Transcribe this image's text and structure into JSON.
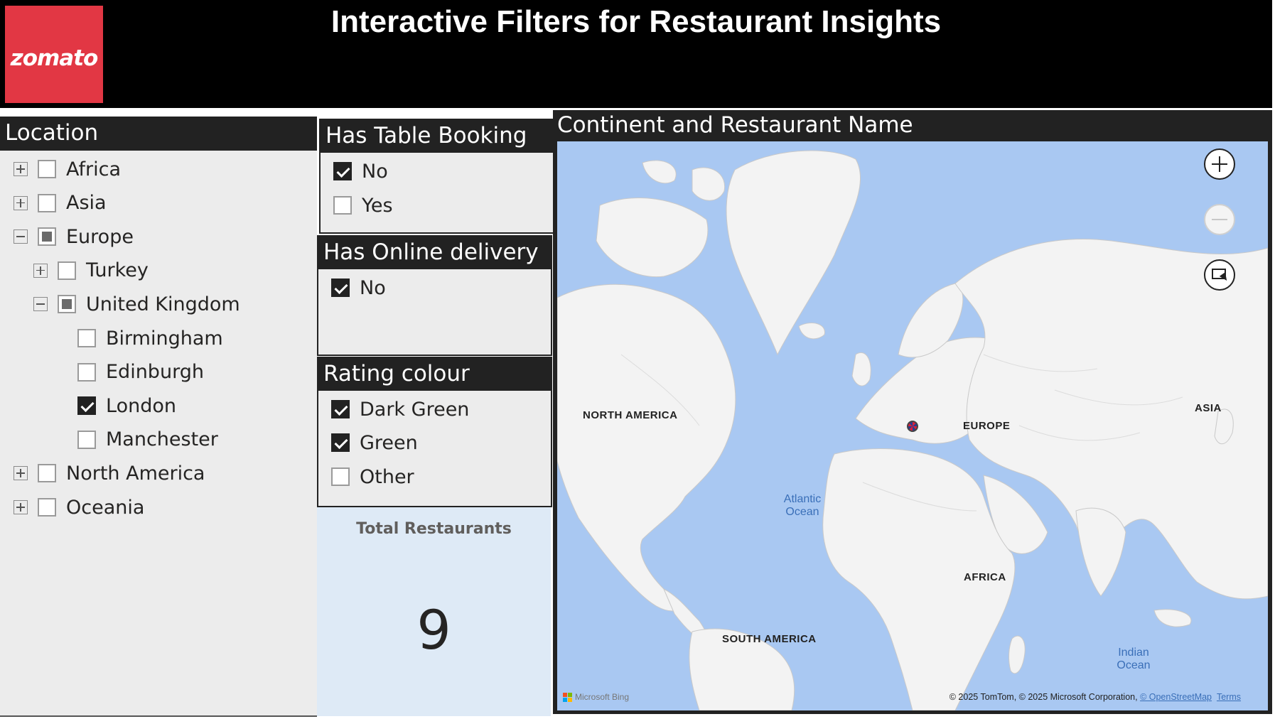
{
  "header": {
    "logo_text": "zomato",
    "title": "Interactive Filters for Restaurant Insights"
  },
  "location_slicer": {
    "title": "Location",
    "items": [
      {
        "label": "Africa",
        "level": 0,
        "expander": "plus",
        "state": "unchecked"
      },
      {
        "label": "Asia",
        "level": 0,
        "expander": "plus",
        "state": "unchecked"
      },
      {
        "label": "Europe",
        "level": 0,
        "expander": "minus",
        "state": "partial"
      },
      {
        "label": "Turkey",
        "level": 1,
        "expander": "plus",
        "state": "unchecked"
      },
      {
        "label": "United Kingdom",
        "level": 1,
        "expander": "minus",
        "state": "partial"
      },
      {
        "label": "Birmingham",
        "level": 2,
        "expander": "none",
        "state": "unchecked"
      },
      {
        "label": "Edinburgh",
        "level": 2,
        "expander": "none",
        "state": "unchecked"
      },
      {
        "label": "London",
        "level": 2,
        "expander": "none",
        "state": "checked"
      },
      {
        "label": "Manchester",
        "level": 2,
        "expander": "none",
        "state": "unchecked"
      },
      {
        "label": "North America",
        "level": 0,
        "expander": "plus",
        "state": "unchecked"
      },
      {
        "label": "Oceania",
        "level": 0,
        "expander": "plus",
        "state": "unchecked"
      }
    ]
  },
  "table_booking_slicer": {
    "title": "Has Table Booking",
    "items": [
      {
        "label": "No",
        "state": "checked"
      },
      {
        "label": "Yes",
        "state": "unchecked"
      }
    ]
  },
  "online_delivery_slicer": {
    "title": "Has Online delivery",
    "items": [
      {
        "label": "No",
        "state": "checked"
      }
    ]
  },
  "rating_colour_slicer": {
    "title": "Rating colour",
    "items": [
      {
        "label": "Dark Green",
        "state": "checked"
      },
      {
        "label": "Green",
        "state": "checked"
      },
      {
        "label": "Other",
        "state": "unchecked"
      }
    ]
  },
  "total_card": {
    "title": "Total Restaurants",
    "value": "9"
  },
  "map": {
    "title": "Continent and Restaurant Name",
    "labels": {
      "north_america": "NORTH AMERICA",
      "europe": "EUROPE",
      "asia": "ASIA",
      "africa": "AFRICA",
      "south_america": "SOUTH AMERICA"
    },
    "oceans": {
      "atlantic_line1": "Atlantic",
      "atlantic_line2": "Ocean",
      "indian_line1": "Indian",
      "indian_line2": "Ocean"
    },
    "bing_label": "Microsoft Bing",
    "attribution": "© 2025 TomTom, © 2025 Microsoft Corporation,",
    "osm_link": "© OpenStreetMap",
    "terms_link": "Terms",
    "colors": {
      "ocean": "#a9c8f2",
      "land": "#f3f3f3",
      "marker_red": "#d8203a",
      "marker_blue": "#2a3b8f"
    }
  },
  "colors": {
    "brand": "#e23744",
    "header_bg": "#000000",
    "slicer_header": "#222222",
    "slicer_bg": "#ececec",
    "card_bg": "#deeaf6"
  }
}
